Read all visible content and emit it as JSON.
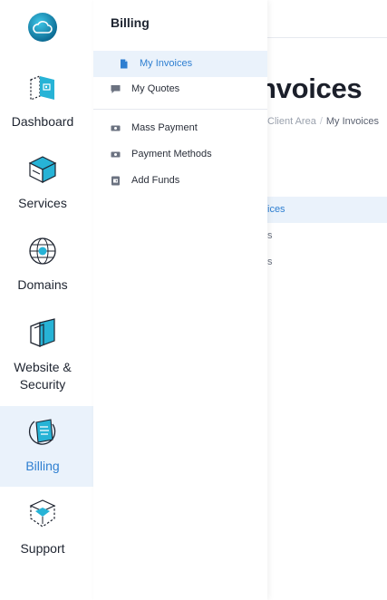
{
  "background": {
    "page_title_fragment": "nvoices",
    "breadcrumb": {
      "parent": "Client Area",
      "separator": "/",
      "current": "My Invoices"
    },
    "rows": [
      "ices",
      "s",
      "s"
    ]
  },
  "rail": {
    "logo_icon": "cloud-logo-icon",
    "items": [
      {
        "label": "Dashboard",
        "icon": "dashboard-icon"
      },
      {
        "label": "Services",
        "icon": "services-cube-icon"
      },
      {
        "label": "Domains",
        "icon": "globe-icon"
      },
      {
        "label_line1": "Website &",
        "label_line2": "Security",
        "icon": "website-security-icon"
      },
      {
        "label": "Billing",
        "icon": "billing-icon",
        "active": true
      },
      {
        "label": "Support",
        "icon": "support-box-icon"
      }
    ]
  },
  "flyout": {
    "title": "Billing",
    "items": [
      {
        "label": "My Invoices",
        "icon": "document-icon",
        "active": true
      },
      {
        "label": "My Quotes",
        "icon": "chat-icon"
      },
      {
        "label": "Mass Payment",
        "icon": "cash-icon"
      },
      {
        "label": "Payment Methods",
        "icon": "cash-icon"
      },
      {
        "label": "Add Funds",
        "icon": "wallet-icon"
      }
    ]
  },
  "colors": {
    "accent": "#2e7fd1",
    "active_bg": "#eaf2fb",
    "icon_teal": "#27b3d6",
    "icon_dark": "#1e2430"
  }
}
